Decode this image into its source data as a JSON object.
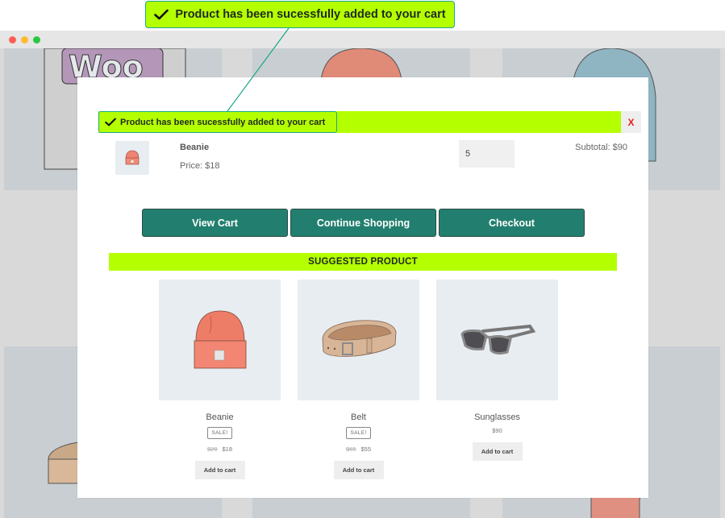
{
  "callout": {
    "message": "Product has been sucessfully added to your cart",
    "icon": "checkmark-icon"
  },
  "window": {
    "controls": [
      "close",
      "minimize",
      "maximize"
    ]
  },
  "modal": {
    "notice": {
      "message": "Product has been sucessfully added to your cart",
      "icon": "checkmark-icon",
      "close_label": "X"
    },
    "cart_item": {
      "name": "Beanie",
      "price_label": "Price: $18",
      "quantity": "5",
      "subtotal_label": "Subtotal: $90"
    },
    "actions": {
      "view_cart": "View Cart",
      "continue_shopping": "Continue Shopping",
      "checkout": "Checkout"
    },
    "suggested_heading": "SUGGESTED PRODUCT",
    "suggested_products": [
      {
        "name": "Beanie",
        "badge": "SALE!",
        "old_price": "$20",
        "price": "$18",
        "button": "Add to cart"
      },
      {
        "name": "Belt",
        "badge": "SALE!",
        "old_price": "$65",
        "price": "$55",
        "button": "Add to cart"
      },
      {
        "name": "Sunglasses",
        "price": "$90",
        "button": "Add to cart"
      }
    ]
  },
  "colors": {
    "accent_green": "#b4ff00",
    "button_teal": "#227f6f",
    "callout_border": "#1aa88a",
    "close_red": "#e02020"
  }
}
